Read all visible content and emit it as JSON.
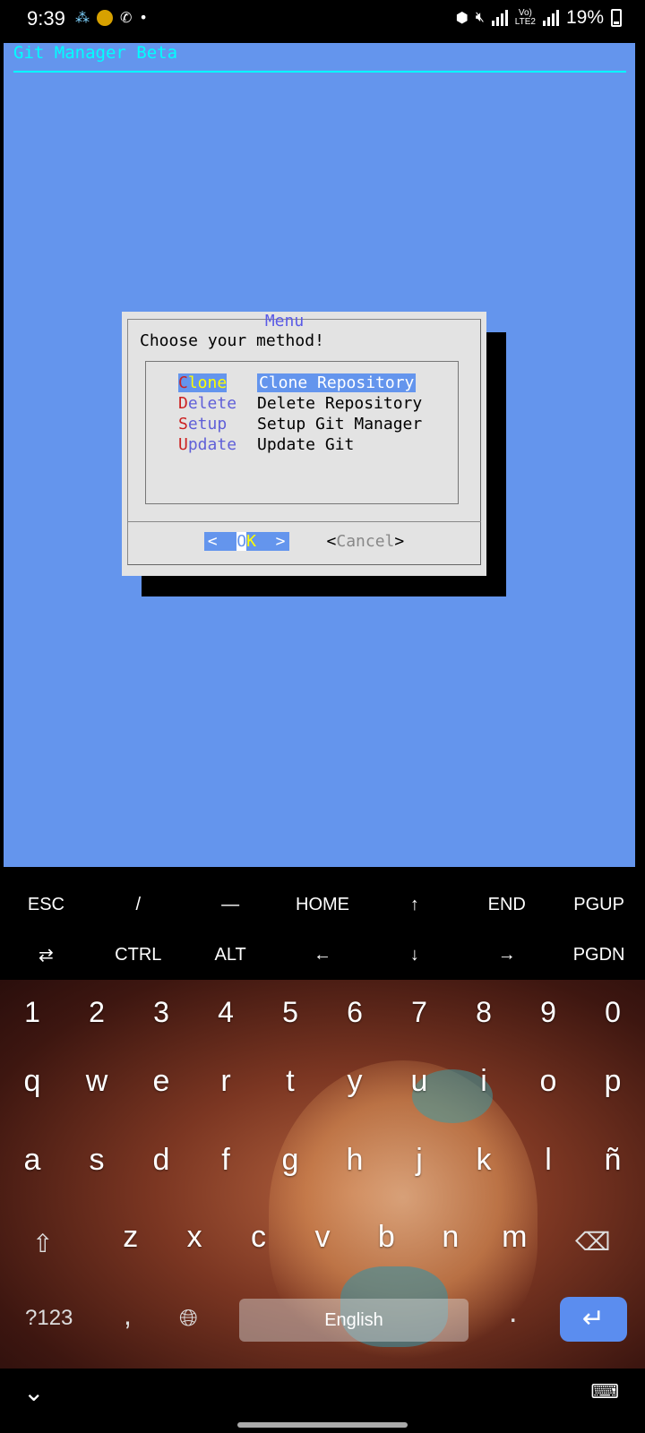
{
  "status_bar": {
    "time": "9:39",
    "battery_percent": "19%",
    "network_label": "LTE2",
    "icons": [
      "notification-icon",
      "app-icon",
      "call-icon",
      "dot-icon",
      "data-saver-icon",
      "mute-icon",
      "signal-icon",
      "volte-icon",
      "battery-icon"
    ]
  },
  "terminal": {
    "backtitle": "Git Manager Beta",
    "colors": {
      "background": "#6495ed",
      "backtitle": "#00ffff",
      "dialog": "#e3e3e3"
    },
    "dialog": {
      "title": "Menu",
      "prompt": "Choose your method!",
      "items": [
        {
          "hotkey": "C",
          "rest": "lone",
          "description": "Clone Repository",
          "selected": true
        },
        {
          "hotkey": "D",
          "rest": "elete",
          "description": "Delete Repository",
          "selected": false
        },
        {
          "hotkey": "S",
          "rest": "etup",
          "description": "Setup Git Manager",
          "selected": false
        },
        {
          "hotkey": "U",
          "rest": "pdate",
          "description": "Update Git",
          "selected": false
        }
      ],
      "ok_button": {
        "left": "<  ",
        "o": "O",
        "k": "K",
        "right": "  >"
      },
      "cancel_button": {
        "open": "<",
        "c": "C",
        "rest": "ancel",
        "close": ">"
      }
    }
  },
  "extra_keys": {
    "row1": [
      "ESC",
      "/",
      "—",
      "HOME",
      "↑",
      "END",
      "PGUP"
    ],
    "row2": [
      "⇄",
      "CTRL",
      "ALT",
      "←",
      "↓",
      "→",
      "PGDN"
    ]
  },
  "keyboard": {
    "numbers": [
      "1",
      "2",
      "3",
      "4",
      "5",
      "6",
      "7",
      "8",
      "9",
      "0"
    ],
    "row1": [
      "q",
      "w",
      "e",
      "r",
      "t",
      "y",
      "u",
      "i",
      "o",
      "p"
    ],
    "row2": [
      "a",
      "s",
      "d",
      "f",
      "g",
      "h",
      "j",
      "k",
      "l",
      "ñ"
    ],
    "row3": [
      "z",
      "x",
      "c",
      "v",
      "b",
      "n",
      "m"
    ],
    "symbols_label": "?123",
    "comma": ",",
    "space_label": "English",
    "period": "."
  }
}
